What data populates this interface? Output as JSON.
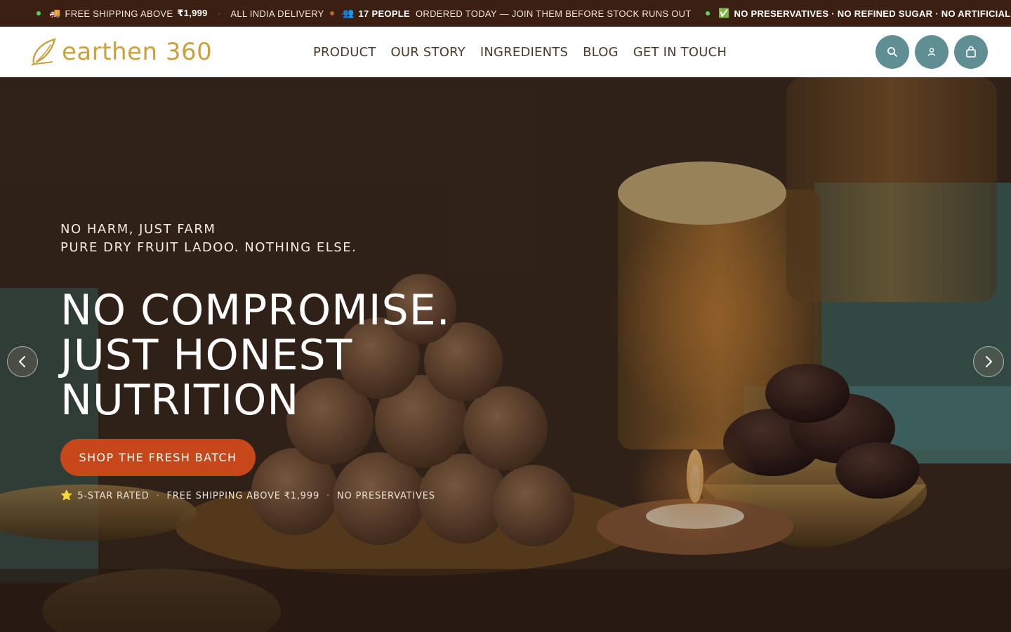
{
  "announcement": {
    "items": [
      {
        "icon": "truck-icon",
        "glyph": "🚚",
        "text_a": "FREE SHIPPING ABOVE",
        "strong": "₹1,999",
        "text_b": "ALL INDIA DELIVERY",
        "dot_color": "#5fcf5f"
      },
      {
        "icon": "people-icon",
        "glyph": "👥",
        "strong": "17 PEOPLE",
        "text_a": "ORDERED TODAY — JOIN THEM BEFORE STOCK RUNS OUT",
        "dot_color": "#b3672a"
      },
      {
        "icon": "check-icon",
        "glyph": "✅",
        "strong": "NO PRESERVATIVES · NO REFINED SUGAR · NO ARTIFICIAL FLA",
        "dot_color": "#5fcf5f"
      }
    ],
    "separator": "·"
  },
  "header": {
    "logo_text": "earthen 360",
    "nav": [
      "PRODUCT",
      "OUR STORY",
      "INGREDIENTS",
      "BLOG",
      "GET IN TOUCH"
    ],
    "icons": [
      "search-icon",
      "account-icon",
      "cart-icon"
    ]
  },
  "hero": {
    "eyebrow_line1": "NO HARM, JUST FARM",
    "eyebrow_line2": "PURE DRY FRUIT LADOO. NOTHING ELSE.",
    "headline": [
      "NO COMPROMISE.",
      "JUST HONEST",
      "NUTRITION"
    ],
    "cta_label": "SHOP THE FRESH BATCH",
    "trust": [
      "5-STAR RATED",
      "FREE SHIPPING ABOVE ₹1,999",
      "NO PRESERVATIVES"
    ],
    "trust_separator": "·",
    "star_glyph": "⭐"
  },
  "colors": {
    "announce_bg": "#3a1f12",
    "logo": "#c9a23c",
    "icon_button": "#5f8f92",
    "cta": "#c5471a"
  }
}
